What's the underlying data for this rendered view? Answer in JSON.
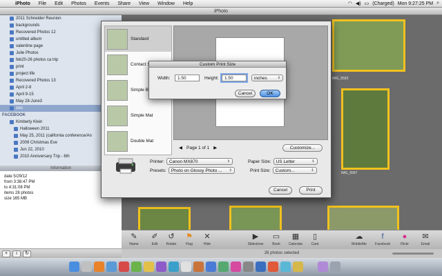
{
  "menubar": {
    "app": "iPhoto",
    "menus": [
      "File",
      "Edit",
      "Photos",
      "Events",
      "Share",
      "View",
      "Window",
      "Help"
    ],
    "battery": "(Charged)",
    "clock": "Mon 9:27:25 PM"
  },
  "window": {
    "title": "iPhoto"
  },
  "sidebar": {
    "albums": [
      "2011 Schneider Reunion",
      "backgrounds",
      "Recovered Photos 12",
      "untitled album",
      "valentine page",
      "Julie Photos",
      "feb20-26 photos ca trip",
      "print",
      "project life",
      "Recovered Photos 13",
      "April 2-8",
      "April 9-15",
      "May 28-June3",
      "zoo"
    ],
    "selected": "zoo",
    "facebook_header": "FACEBOOK",
    "facebook_account": "Kimberly Klein",
    "facebook_albums": [
      "Halloween 2011",
      "May 25, 2011 (california conference/An",
      "2009 Christmas Eve",
      "Jun 22, 2010",
      "2010 Anniversary Trip - 6th"
    ]
  },
  "info": {
    "header": "Information",
    "date_label": "date",
    "date": "5/29/12",
    "from_label": "from",
    "from": "3:38:47 PM",
    "to_label": "to",
    "to": "4:31:08 PM",
    "items_label": "items",
    "items": "28 photos",
    "size_label": "size",
    "size": "165 MB"
  },
  "grid": {
    "captions": [
      "IMG_5592",
      "IMG_5597"
    ]
  },
  "print": {
    "themes": [
      "Standard",
      "Contact Sheet",
      "Simple Border",
      "Simple Mat",
      "Double Mat"
    ],
    "page": "Page 1 of 1",
    "customize": "Customize...",
    "printer_label": "Printer:",
    "printer": "Canon MX870",
    "presets_label": "Presets:",
    "presets": "Photo on Glossy Photo ...",
    "paper_size_label": "Paper Size:",
    "paper_size": "US Letter",
    "print_size_label": "Print Size:",
    "print_size": "Custom...",
    "cancel": "Cancel",
    "print": "Print"
  },
  "custom_size": {
    "title": "Custom Print Size",
    "width_label": "Width:",
    "width": "1.50",
    "height_label": "Height:",
    "height": "1.50",
    "unit": "inches",
    "cancel": "Cancel",
    "ok": "OK"
  },
  "toolbar": {
    "tools": [
      "Name",
      "Edit",
      "Rotate",
      "Flag",
      "Hide",
      "Slideshow",
      "Book",
      "Calendar",
      "Card",
      "MobileMe",
      "Facebook",
      "Flickr",
      "Email"
    ]
  },
  "status": "26 photos selected"
}
